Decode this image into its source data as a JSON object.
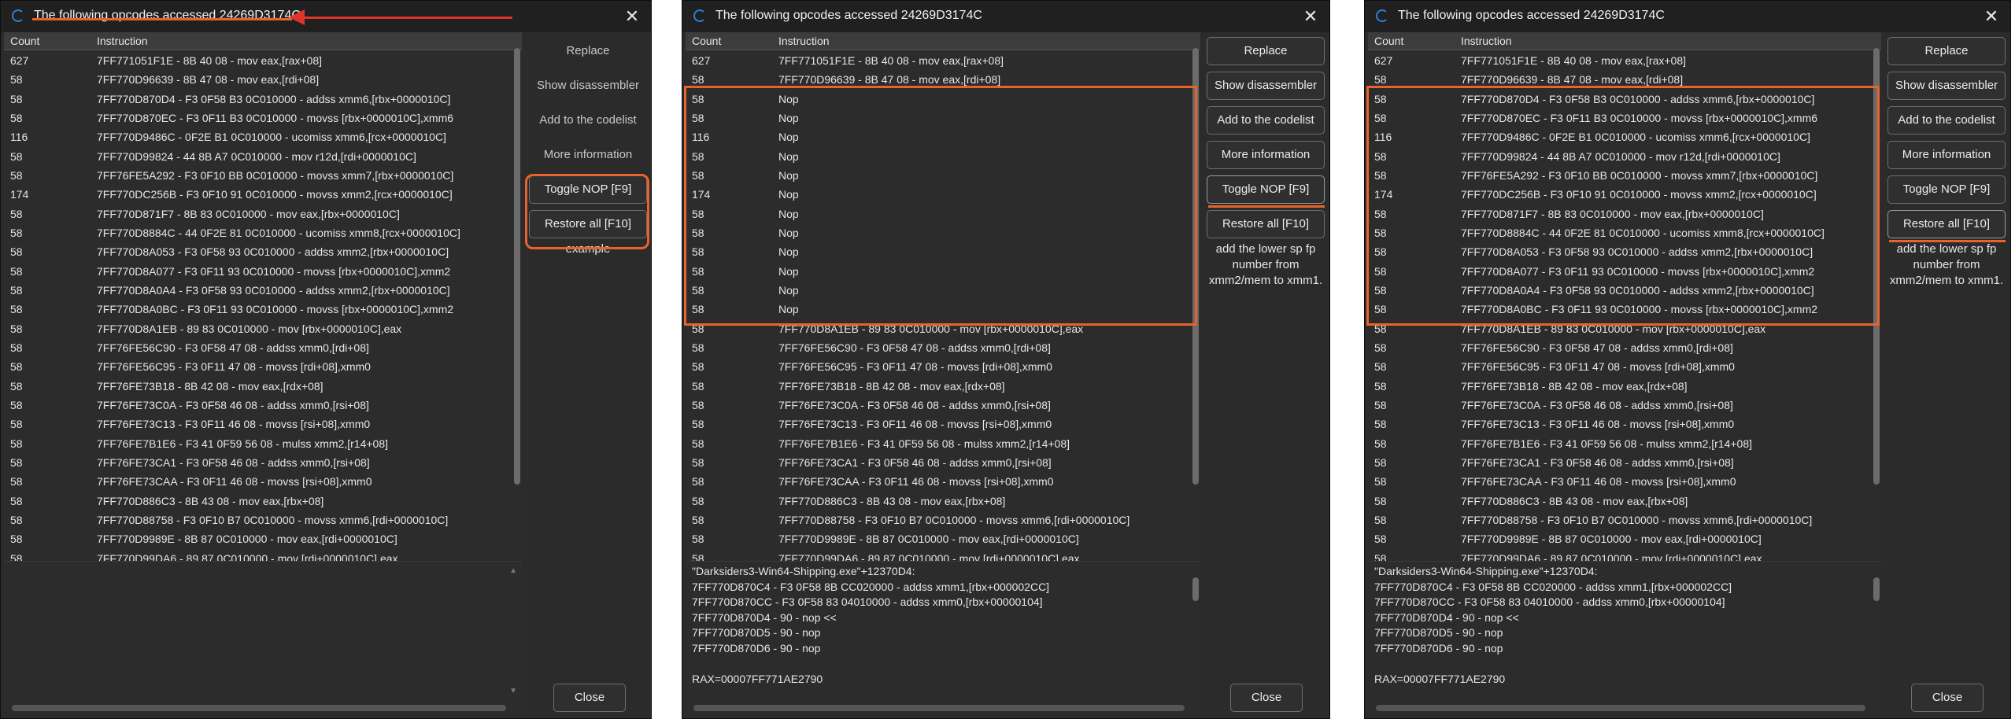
{
  "window_title": "The following opcodes accessed 24269D3174C",
  "columns": {
    "count": "Count",
    "instruction": "Instruction"
  },
  "buttons": {
    "replace": "Replace",
    "show_disassembler": "Show disassembler",
    "add_to_codelist": "Add to the codelist",
    "more_information": "More information",
    "toggle_nop": "Toggle NOP [F9]",
    "restore_all": "Restore all [F10]",
    "close": "Close"
  },
  "note_text_1": "example",
  "note_text_2": "add the lower sp fp number from xmm2/mem to xmm1.",
  "accent_colors": {
    "highlight": "#e8632b",
    "arrow": "#e0342b",
    "background": "#2b2b2b"
  },
  "original_rows": [
    {
      "count": "627",
      "instruction": "7FF771051F1E - 8B 40 08  - mov eax,[rax+08]"
    },
    {
      "count": "58",
      "instruction": "7FF770D96639 - 8B 47 08  - mov eax,[rdi+08]"
    },
    {
      "count": "58",
      "instruction": "7FF770D870D4 - F3 0F58 B3 0C010000  - addss xmm6,[rbx+0000010C]"
    },
    {
      "count": "58",
      "instruction": "7FF770D870EC - F3 0F11 B3 0C010000  - movss [rbx+0000010C],xmm6"
    },
    {
      "count": "116",
      "instruction": "7FF770D9486C - 0F2E B1 0C010000  - ucomiss xmm6,[rcx+0000010C]"
    },
    {
      "count": "58",
      "instruction": "7FF770D99824 - 44 8B A7 0C010000  - mov r12d,[rdi+0000010C]"
    },
    {
      "count": "58",
      "instruction": "7FF76FE5A292 - F3 0F10 BB 0C010000  - movss xmm7,[rbx+0000010C]"
    },
    {
      "count": "174",
      "instruction": "7FF770DC256B - F3 0F10 91 0C010000  - movss xmm2,[rcx+0000010C]"
    },
    {
      "count": "58",
      "instruction": "7FF770D871F7 - 8B 83 0C010000  - mov eax,[rbx+0000010C]"
    },
    {
      "count": "58",
      "instruction": "7FF770D8884C - 44 0F2E 81 0C010000  - ucomiss xmm8,[rcx+0000010C]"
    },
    {
      "count": "58",
      "instruction": "7FF770D8A053 - F3 0F58 93 0C010000  - addss xmm2,[rbx+0000010C]"
    },
    {
      "count": "58",
      "instruction": "7FF770D8A077 - F3 0F11 93 0C010000  - movss [rbx+0000010C],xmm2"
    },
    {
      "count": "58",
      "instruction": "7FF770D8A0A4 - F3 0F58 93 0C010000  - addss xmm2,[rbx+0000010C]"
    },
    {
      "count": "58",
      "instruction": "7FF770D8A0BC - F3 0F11 93 0C010000  - movss [rbx+0000010C],xmm2"
    },
    {
      "count": "58",
      "instruction": "7FF770D8A1EB - 89 83 0C010000  - mov [rbx+0000010C],eax"
    },
    {
      "count": "58",
      "instruction": "7FF76FE56C90 - F3 0F58 47 08  - addss xmm0,[rdi+08]"
    },
    {
      "count": "58",
      "instruction": "7FF76FE56C95 - F3 0F11 47 08  - movss [rdi+08],xmm0"
    },
    {
      "count": "58",
      "instruction": "7FF76FE73B18 - 8B 42 08  - mov eax,[rdx+08]"
    },
    {
      "count": "58",
      "instruction": "7FF76FE73C0A - F3 0F58 46 08  - addss xmm0,[rsi+08]"
    },
    {
      "count": "58",
      "instruction": "7FF76FE73C13 - F3 0F11 46 08  - movss [rsi+08],xmm0"
    },
    {
      "count": "58",
      "instruction": "7FF76FE7B1E6 - F3 41 0F59 56 08  - mulss xmm2,[r14+08]"
    },
    {
      "count": "58",
      "instruction": "7FF76FE73CA1 - F3 0F58 46 08  - addss xmm0,[rsi+08]"
    },
    {
      "count": "58",
      "instruction": "7FF76FE73CAA - F3 0F11 46 08  - movss [rsi+08],xmm0"
    },
    {
      "count": "58",
      "instruction": "7FF770D886C3 - 8B 43 08  - mov eax,[rbx+08]"
    },
    {
      "count": "58",
      "instruction": "7FF770D88758 - F3 0F10 B7 0C010000  - movss xmm6,[rdi+0000010C]"
    },
    {
      "count": "58",
      "instruction": "7FF770D9989E - 8B 87 0C010000  - mov eax,[rdi+0000010C]"
    },
    {
      "count": "58",
      "instruction": "7FF770D99DA6 - 89 87 0C010000  - mov [rdi+0000010C],eax"
    }
  ],
  "nop_label": "Nop",
  "nop_partial_rows": [
    {
      "count": "58",
      "instruction": "7FF770D8A1EB - 89 83 0C010000  - mov [rbx+0000010C],eax"
    }
  ],
  "disasm_lines": [
    "\"Darksiders3-Win64-Shipping.exe\"+12370D4:",
    "7FF770D870C4 - F3 0F58 8B CC020000  - addss xmm1,[rbx+000002CC]",
    "7FF770D870CC - F3 0F58 83 04010000  - addss xmm0,[rbx+00000104]",
    "7FF770D870D4 - 90 - nop  <<",
    "7FF770D870D5 - 90 - nop",
    "7FF770D870D6 - 90 - nop",
    "",
    "RAX=00007FF771AE2790"
  ]
}
